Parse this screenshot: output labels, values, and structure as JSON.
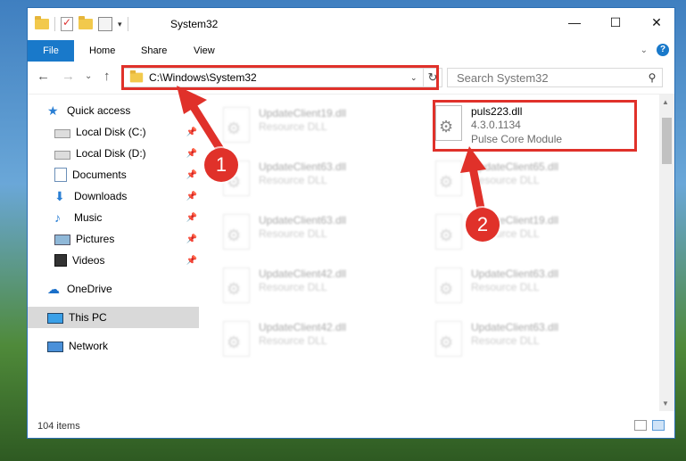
{
  "window": {
    "title": "System32",
    "controls": {
      "minimize": "—",
      "maximize": "☐",
      "close": "✕"
    }
  },
  "ribbon": {
    "tabs": [
      "File",
      "Home",
      "Share",
      "View"
    ]
  },
  "nav": {
    "back": "←",
    "forward": "→",
    "recent": "⌄",
    "up": "↑",
    "address": "C:\\Windows\\System32",
    "search_placeholder": "Search System32"
  },
  "sidebar": {
    "items": [
      {
        "label": "Quick access",
        "icon": "star-icon"
      },
      {
        "label": "Local Disk (C:)",
        "icon": "drive-icon",
        "pinned": true
      },
      {
        "label": "Local Disk (D:)",
        "icon": "drive-icon",
        "pinned": true
      },
      {
        "label": "Documents",
        "icon": "documents-icon",
        "pinned": true
      },
      {
        "label": "Downloads",
        "icon": "downloads-icon",
        "pinned": true
      },
      {
        "label": "Music",
        "icon": "music-icon",
        "pinned": true
      },
      {
        "label": "Pictures",
        "icon": "pictures-icon",
        "pinned": true
      },
      {
        "label": "Videos",
        "icon": "videos-icon",
        "pinned": true
      },
      {
        "label": "OneDrive",
        "icon": "onedrive-icon"
      },
      {
        "label": "This PC",
        "icon": "this-pc-icon",
        "selected": true
      },
      {
        "label": "Network",
        "icon": "network-icon"
      }
    ]
  },
  "files": {
    "highlighted": {
      "name": "puls223.dll",
      "version": "4.3.0.1134",
      "description": "Pulse Core Module"
    },
    "left_column": [
      {
        "name": "UpdateClient19.dll",
        "description": "Resource DLL"
      },
      {
        "name": "UpdateClient63.dll",
        "description": "Resource DLL"
      },
      {
        "name": "UpdateClient63.dll",
        "description": "Resource DLL"
      },
      {
        "name": "UpdateClient42.dll",
        "description": "Resource DLL"
      },
      {
        "name": "UpdateClient42.dll",
        "description": "Resource DLL"
      }
    ],
    "right_column": [
      {
        "name": "UpdateClient65.dll",
        "description": "Resource DLL"
      },
      {
        "name": "UpdateClient19.dll",
        "description": "Resource DLL"
      },
      {
        "name": "UpdateClient63.dll",
        "description": "Resource DLL"
      },
      {
        "name": "UpdateClient63.dll",
        "description": "Resource DLL"
      }
    ]
  },
  "status": {
    "item_count": "104 items"
  },
  "annotations": {
    "step1": "1",
    "step2": "2",
    "color": "#e0312a"
  }
}
